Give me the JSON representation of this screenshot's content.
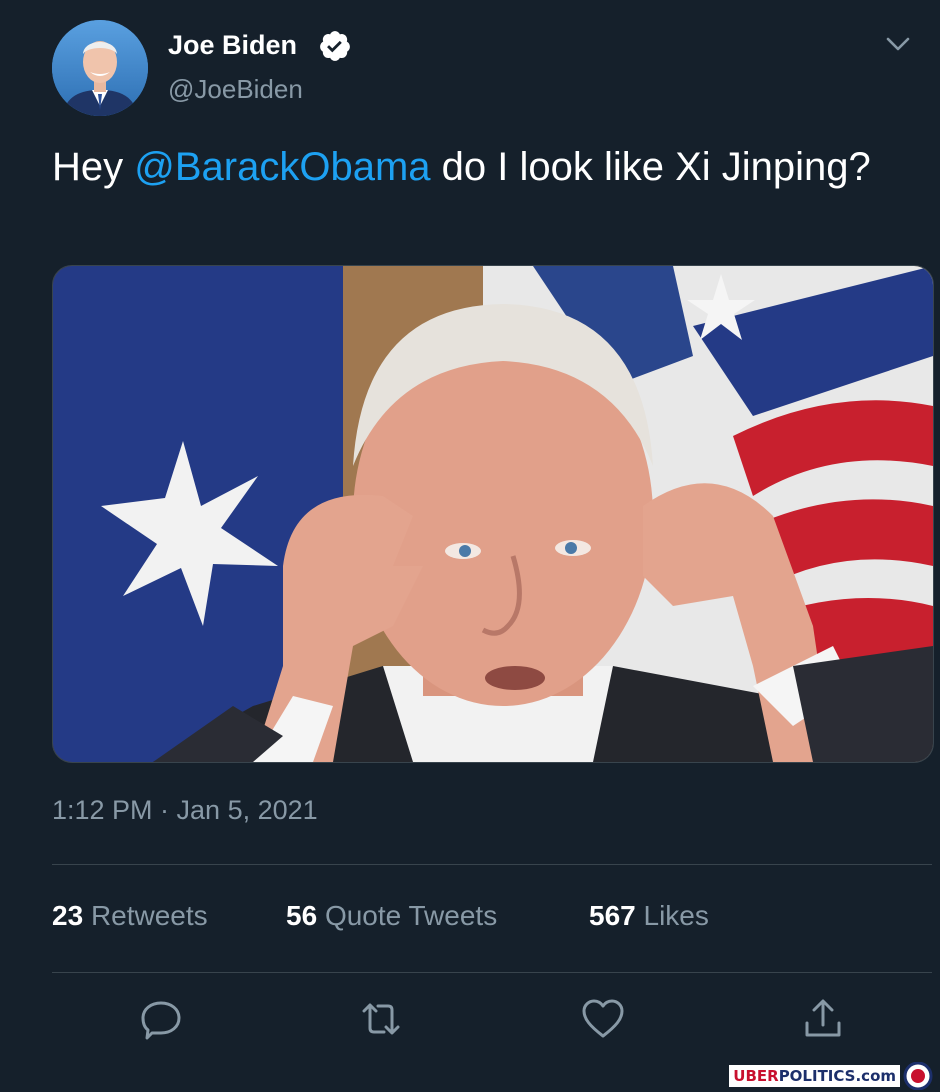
{
  "tweet": {
    "author": {
      "name": "Joe Biden",
      "handle": "@JoeBiden",
      "verified": true
    },
    "text": {
      "before": "Hey ",
      "mention": "@BarackObama",
      "after": " do I look like Xi Jinping?"
    },
    "timestamp": "1:12 PM · Jan 5, 2021",
    "stats": [
      {
        "count": "23",
        "label": "Retweets"
      },
      {
        "count": "56",
        "label": "Quote Tweets"
      },
      {
        "count": "567",
        "label": "Likes"
      }
    ],
    "actions": [
      "reply-icon",
      "retweet-icon",
      "like-icon",
      "share-icon"
    ]
  },
  "watermark": {
    "part1": "UBER",
    "part2": "POLITICS.com"
  },
  "colors": {
    "background": "#15202b",
    "accent": "#1da1f2",
    "secondary_text": "#8899a6",
    "divider": "#38444d"
  }
}
